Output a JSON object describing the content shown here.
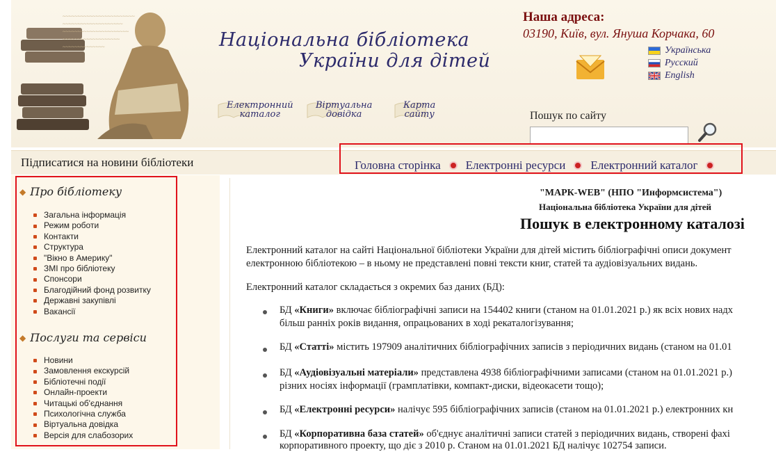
{
  "header": {
    "title_line1": "Національна бібліотека",
    "title_line2": "України для дітей",
    "nav_buttons": [
      {
        "label": "Електронний\nкаталог"
      },
      {
        "label": "Віртуальна\nдовідка"
      },
      {
        "label": "Карта\nсайту"
      }
    ],
    "address_title": "Наша адреса:",
    "address": "03190, Київ, вул. Януша Корчака, 60",
    "languages": [
      {
        "label": "Українська",
        "icon": "flag-ukraine"
      },
      {
        "label": "Русский",
        "icon": "flag-russia"
      },
      {
        "label": "English",
        "icon": "flag-uk"
      }
    ],
    "search_label": "Пошук по сайту",
    "search_placeholder": ""
  },
  "subbar": {
    "subscribe": "Підписатися на новини бібліотеки",
    "topnav": [
      "Головна сторінка",
      "Електронні ресурси",
      "Електронний каталог"
    ]
  },
  "sidebar": {
    "sections": [
      {
        "title": "Про бібліотеку",
        "items": [
          "Загальна інформація",
          "Режим роботи",
          "Контакти",
          "Структура",
          "\"Вікно в Америку\"",
          "ЗМІ про бібліотеку",
          "Спонсори",
          "Благодійний фонд розвитку",
          "Державні закупівлі",
          "Вакансії"
        ]
      },
      {
        "title": "Послуги та сервіси",
        "items": [
          "Новини",
          "Замовлення екскурсій",
          "Бібліотечні події",
          "Онлайн-проекти",
          "Читацькі об'єднання",
          "Психологічна служба",
          "Віртуальна довідка",
          "Версія для слабозорих"
        ]
      }
    ]
  },
  "content": {
    "head1": "\"МАРК-WEB\" (НПО \"Информсистема\")",
    "head2": "Національна бібліотека України для дітей",
    "title": "Пошук в електронному каталозі",
    "intro1": "Електронний каталог на сайті Національної бібліотеки України для дітей містить бібліографічні описи документ",
    "intro2": "електронною бібліотекою – в ньому не представлені повні тексти книг, статей та аудіовізуальних видань.",
    "intro3": "Електронний каталог складається з окремих баз даних (БД):",
    "bullets": [
      {
        "prefix": "БД ",
        "name": "«Книги»",
        "line1": " включає бібліографічні записи на 154402 книги (станом на 01.01.2021 р.) як всіх нових надх",
        "line2": "більш ранніх років видання, опрацьованих в ході рекаталогізування;"
      },
      {
        "prefix": "БД ",
        "name": "«Статті»",
        "line1": " містить 197909 аналітичних бібліографічних записів з періодичних видань (станом на 01.01",
        "line2": ""
      },
      {
        "prefix": "БД ",
        "name": "«Аудіовізуальні матеріали»",
        "line1": " представлена 4938 бібліографічними записами (станом на 01.01.2021 р.)",
        "line2": "різних носіях інформації (грамплатівки, компакт-диски, відеокасети тощо);"
      },
      {
        "prefix": "БД ",
        "name": "«Електронні ресурси»",
        "line1": " налічує 595 бібліографічних записів (станом на 01.01.2021 р.) електронних кн",
        "line2": ""
      },
      {
        "prefix": "БД ",
        "name": "«Корпоративна база статей»",
        "line1": " об'єднує аналітичні записи статей з періодичних видань, створені фахі",
        "line2": "корпоративного проекту, що діє з 2010 р. Станом на 01.01.2021 БД налічує 102754 записи."
      }
    ]
  },
  "colors": {
    "title": "#2c2a6b",
    "address": "#7a0f0f",
    "highlight_box": "#e0121b",
    "bullet_marker": "#d04a1a"
  }
}
